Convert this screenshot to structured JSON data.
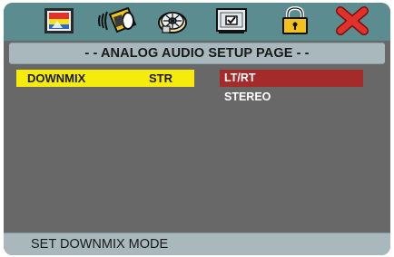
{
  "icons": [
    {
      "name": "general-setup-icon",
      "selected": false
    },
    {
      "name": "audio-setup-icon",
      "selected": true
    },
    {
      "name": "dolby-setup-icon",
      "selected": false
    },
    {
      "name": "preference-icon",
      "selected": false
    },
    {
      "name": "password-lock-icon",
      "selected": false
    },
    {
      "name": "exit-icon",
      "selected": false
    }
  ],
  "page": {
    "title": "- - ANALOG AUDIO SETUP PAGE - -"
  },
  "settings": [
    {
      "label": "DOWNMIX",
      "value": "STR"
    }
  ],
  "options": [
    {
      "label": "LT/RT",
      "selected": true
    },
    {
      "label": "STEREO",
      "selected": false
    }
  ],
  "status": {
    "text": "SET DOWNMIX MODE"
  },
  "colors": {
    "frame": "#686868",
    "icon_bar": "#5a8c90",
    "title_bar": "#a8b8bd",
    "highlight_row": "#f5ec0c",
    "selected_option": "#a52a2a",
    "text_light": "#ffffff",
    "text_dark": "#1a1a1a"
  }
}
